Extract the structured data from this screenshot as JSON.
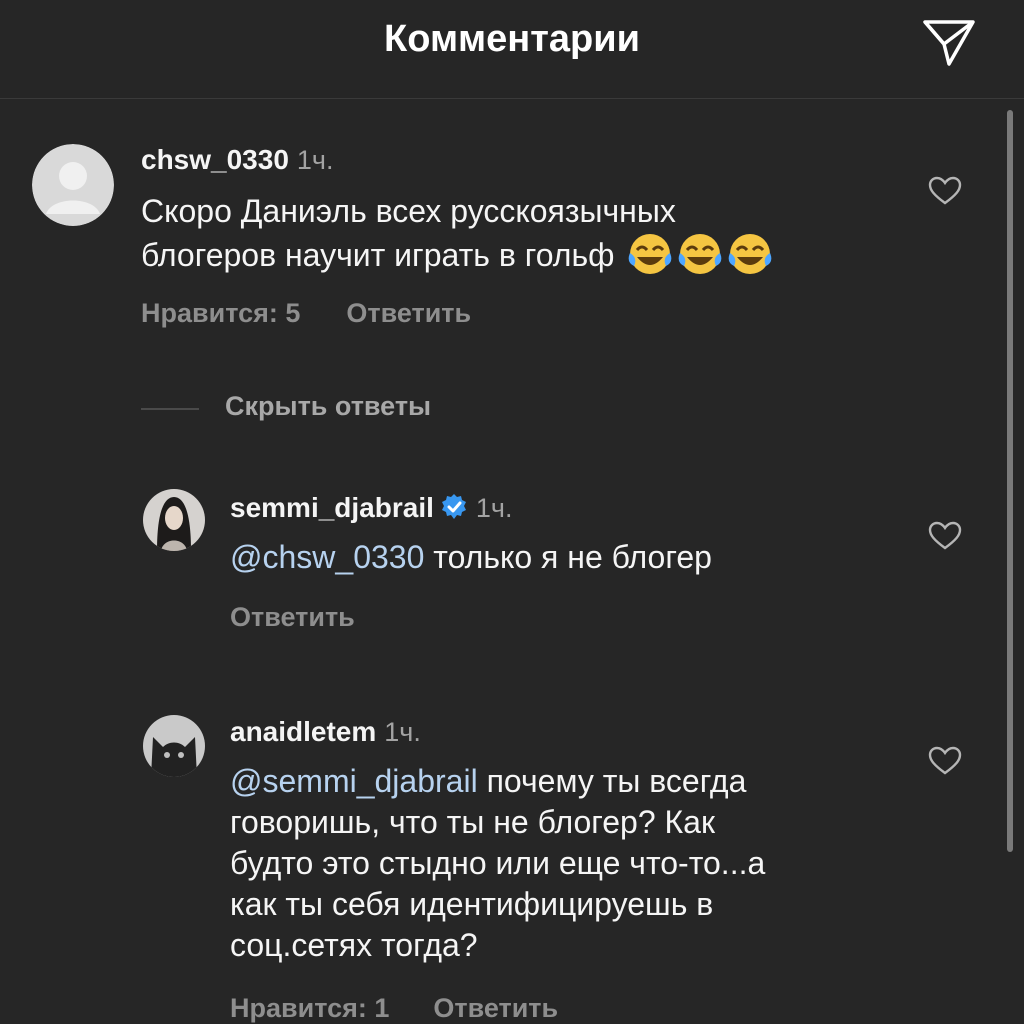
{
  "header": {
    "title": "Комментарии"
  },
  "comments": [
    {
      "username": "chsw_0330",
      "time": "1ч.",
      "text_lines": [
        "Скоро Даниэль всех русскоязычных",
        "блогеров научит играть в гольф"
      ],
      "emoji": [
        "face-with-tears-of-joy",
        "face-with-tears-of-joy",
        "face-with-tears-of-joy"
      ],
      "likes_label": "Нравится: 5",
      "reply_label": "Ответить"
    }
  ],
  "hide_replies_label": "Скрыть ответы",
  "replies": [
    {
      "username": "semmi_djabrail",
      "verified": true,
      "time": "1ч.",
      "mention": "@chsw_0330",
      "text_lines": [
        " только я не блогер"
      ],
      "reply_label": "Ответить"
    },
    {
      "username": "anaidletem",
      "time": "1ч.",
      "mention": "@semmi_djabrail",
      "text_lines": [
        " почему ты всегда",
        "говоришь, что ты не блогер? Как",
        "будто это стыдно или еще что-то...а",
        "как ты себя идентифицируешь в",
        "соц.сетях тогда?"
      ],
      "likes_label": "Нравится: 1",
      "reply_label": "Ответить"
    }
  ],
  "icons": {
    "share": "paper-plane-icon",
    "like": "heart-outline-icon",
    "verified": "verified-badge-icon"
  },
  "colors": {
    "background": "#262626",
    "text": "#f5f5f5",
    "muted": "#8e8e8e",
    "mention": "#b7d2ef",
    "verified": "#3897f0"
  }
}
